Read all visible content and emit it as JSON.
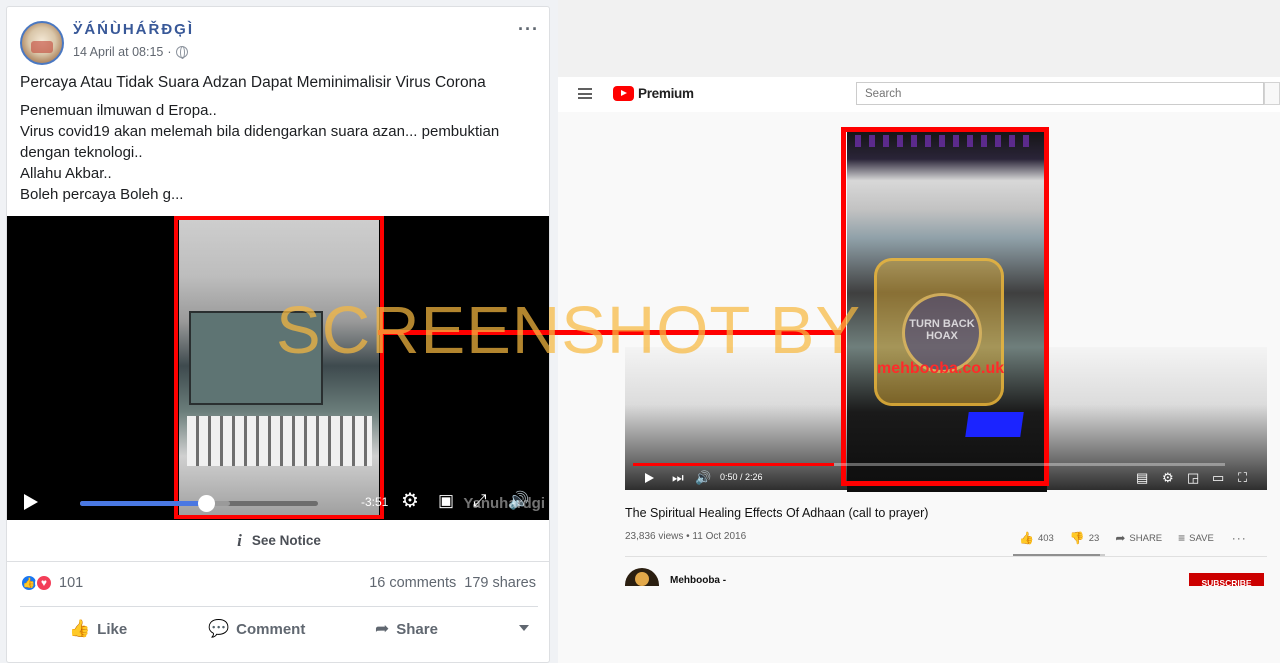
{
  "facebook_post": {
    "author": "ӰÁŃÙHÁŘĐĢÌ",
    "date": "14 April at 08:15",
    "date_separator": "·",
    "more_icon": "···",
    "headline": "Percaya Atau Tidak Suara Adzan Dapat Meminimalisir Virus Corona",
    "body_lines": [
      "Penemuan ilmuwan d Eropa..",
      "Virus covid19 akan melemah bila didengarkan suara azan... pembuktian",
      "dengan teknologi..",
      "Allahu Akbar..",
      "Boleh percaya Boleh g..."
    ],
    "video": {
      "time_remaining": "-3:51",
      "watermark": "Yanuhardgi",
      "progress_fraction": 0.53,
      "buffered_fraction": 0.63
    },
    "notice_label": "See Notice",
    "reaction_count": "101",
    "comments": "16 comments",
    "shares": "179 shares",
    "actions": {
      "like": "Like",
      "comment": "Comment",
      "share": "Share"
    }
  },
  "youtube": {
    "logo_text": "Premium",
    "search_placeholder": "Search",
    "video": {
      "time": "0:50 / 2:26",
      "progress_fraction": 0.34,
      "badge_text": "TURN BACK HOAX",
      "overlay_url": "mehbooba.co.uk"
    },
    "title": "The Spiritual Healing Effects Of Adhaan (call to prayer)",
    "views_date": "23,836 views • 11 Oct 2016",
    "likes": "403",
    "dislikes": "23",
    "like_ratio": 0.946,
    "share_label": "SHARE",
    "save_label": "SAVE",
    "more_icon": "···",
    "channel_name": "Mehbooba -",
    "subscribe_label": "SUBSCRIBE"
  },
  "overlay_watermark": "SCREENSHOT BY",
  "colors": {
    "fb_blue": "#385898",
    "yt_red": "#ff0000",
    "highlight_red": "#ff0000",
    "watermark_orange": "#f7b840"
  }
}
